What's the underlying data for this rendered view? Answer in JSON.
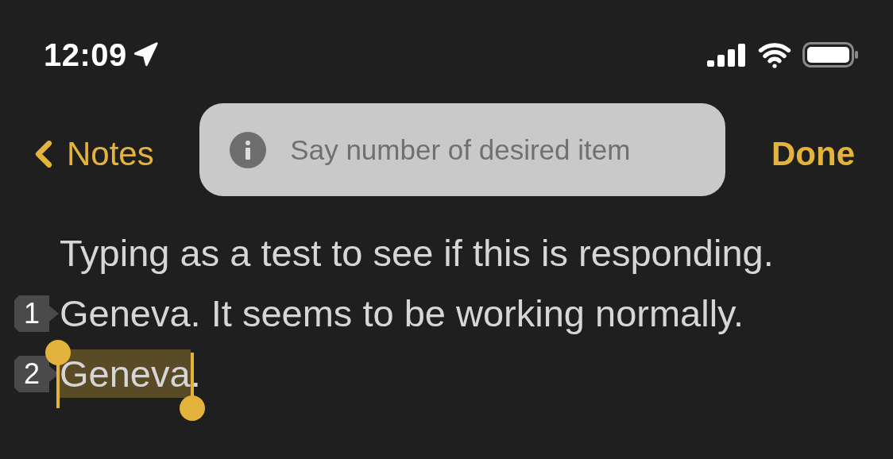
{
  "status_bar": {
    "time": "12:09"
  },
  "nav": {
    "back_label": "Notes",
    "done_label": "Done"
  },
  "toast": {
    "text": "Say number of desired item"
  },
  "lines": [
    {
      "segments": [
        {
          "text": "Typing as a test to see if this is responding.",
          "selected": false
        }
      ]
    },
    {
      "badge": "1",
      "segments": [
        {
          "text": "Geneva. It seems to be working normally.",
          "selected": false
        }
      ]
    },
    {
      "badge": "2",
      "segments": [
        {
          "text": "Geneva",
          "selected": true
        },
        {
          "text": ".",
          "selected": false
        }
      ]
    }
  ]
}
